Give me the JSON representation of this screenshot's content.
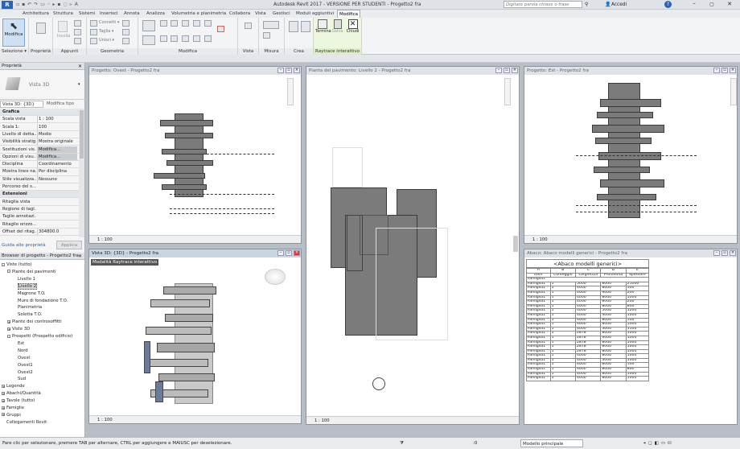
{
  "app_title": "Autodesk Revit 2017 -  VERSIONE PER STUDENTI -   Progetto2 fra",
  "search_placeholder": "Digitare parola chiave o frase",
  "signin": "Accedi",
  "ribbon_tabs": [
    "Architettura",
    "Struttura",
    "Sistemi",
    "Inserisci",
    "Annota",
    "Analizza",
    "Volumetria e planimetria",
    "Collabora",
    "Vista",
    "Gestisci",
    "Moduli aggiuntivi",
    "Modifica"
  ],
  "ribbon": {
    "modify_btn": "Modifica",
    "panels": [
      "Selezione ▾",
      "Proprietà",
      "Appunti",
      "Geometria",
      "Modifica",
      "Vista",
      "Misura",
      "Crea",
      "Raytrace interattivo"
    ],
    "geom_labels": [
      "Connetti ▾",
      "Taglia ▾",
      "Unisci ▾"
    ],
    "paste_label": "Incolla",
    "raytrace_btns": [
      "Termina",
      "Salva",
      "Chiudi"
    ]
  },
  "properties": {
    "header": "Proprietà",
    "type_name": "Vista 3D",
    "selector": "Vista 3D: {3D}",
    "edit_type": "Modifica tipo",
    "rows": [
      {
        "k": "Grafica",
        "v": "",
        "section": true
      },
      {
        "k": "Scala vista",
        "v": "1 : 100"
      },
      {
        "k": "Scala  1:",
        "v": "100"
      },
      {
        "k": "Livello di detta...",
        "v": "Medio"
      },
      {
        "k": "Visibilità stratig...",
        "v": "Mostra originale"
      },
      {
        "k": "Sostituzioni vis...",
        "v": "Modifica..."
      },
      {
        "k": "Opzioni di visu...",
        "v": "Modifica..."
      },
      {
        "k": "Disciplina",
        "v": "Coordinamento"
      },
      {
        "k": "Mostra linee na...",
        "v": "Per disciplina"
      },
      {
        "k": "Stile visualizza...",
        "v": "Nessuno"
      },
      {
        "k": "Percorso del s...",
        "v": ""
      },
      {
        "k": "Estensioni",
        "v": "",
        "section": true
      },
      {
        "k": "Ritaglia vista",
        "v": ""
      },
      {
        "k": "Regione di tagl...",
        "v": ""
      },
      {
        "k": "Taglio annotazi...",
        "v": ""
      },
      {
        "k": "Ritaglio orizzo...",
        "v": ""
      },
      {
        "k": "Offset del ritag...",
        "v": "304800.0"
      }
    ],
    "help_link": "Guida alle proprietà",
    "apply_btn": "Applica"
  },
  "browser": {
    "header": "Browser di progetto - Progetto2 fra",
    "items": [
      {
        "t": "Viste (tutto)",
        "lvl": 0,
        "tog": "-"
      },
      {
        "t": "Piante dei pavimenti",
        "lvl": 1,
        "tog": "-"
      },
      {
        "t": "Livello 1",
        "lvl": 2
      },
      {
        "t": "Livello 2",
        "lvl": 2,
        "sel": true
      },
      {
        "t": "Magrone T.O.",
        "lvl": 2
      },
      {
        "t": "Muro di fondazione T.O.",
        "lvl": 2
      },
      {
        "t": "Planimetria",
        "lvl": 2
      },
      {
        "t": "Soletta T.O.",
        "lvl": 2
      },
      {
        "t": "Piante dei controsoffitti",
        "lvl": 1,
        "tog": "+"
      },
      {
        "t": "Viste 3D",
        "lvl": 1,
        "tog": "+"
      },
      {
        "t": "Prospetti (Prospetto edificio)",
        "lvl": 1,
        "tog": "-"
      },
      {
        "t": "Est",
        "lvl": 2
      },
      {
        "t": "Nord",
        "lvl": 2
      },
      {
        "t": "Ovest",
        "lvl": 2
      },
      {
        "t": "Ovest1",
        "lvl": 2
      },
      {
        "t": "Ovest2",
        "lvl": 2
      },
      {
        "t": "Sud",
        "lvl": 2
      },
      {
        "t": "Legende",
        "lvl": 0,
        "tog": "+"
      },
      {
        "t": "Abachi/Quantità",
        "lvl": 0,
        "tog": "+"
      },
      {
        "t": "Tavole (tutto)",
        "lvl": 0,
        "tog": "+"
      },
      {
        "t": "Famiglie",
        "lvl": 0,
        "tog": "+"
      },
      {
        "t": "Gruppi",
        "lvl": 0,
        "tog": "+"
      },
      {
        "t": "Collegamenti Revit",
        "lvl": 0
      }
    ]
  },
  "views": {
    "ovest": {
      "title": "Progetto: Ovest - Progetto2 fra",
      "scale": "1 : 100"
    },
    "plan": {
      "title": "Pianta del pavimento: Livello 2 - Progetto2 fra",
      "scale": "1 : 100"
    },
    "est": {
      "title": "Progetto: Est - Progetto2 fra",
      "scale": "1 : 100"
    },
    "v3d": {
      "title": "Vista 3D: {3D} - Progetto2 fra",
      "scale": "1 : 100",
      "mode_label": "Modalità Raytrace interattivo"
    },
    "schedule": {
      "title": "Abaco: Abaco modelli generici - Progetto2 fra"
    }
  },
  "schedule": {
    "title": "<Abaco modelli generici>",
    "letters": [
      "A",
      "B",
      "C",
      "D",
      "E"
    ],
    "headers": [
      "Item",
      "Conteggio",
      "Larghezza",
      "Profondità",
      "Spessore"
    ],
    "group": "Famiglia1",
    "rows": [
      [
        "Famiglia1",
        "1",
        "5000",
        "8000",
        "21000"
      ],
      [
        "Famiglia1",
        "1",
        "4000",
        "8000",
        "500"
      ],
      [
        "Famiglia1",
        "1",
        "4000",
        "9000",
        "200"
      ],
      [
        "Famiglia1",
        "1",
        "4000",
        "8000",
        "1000"
      ],
      [
        "Famiglia1",
        "1",
        "4000",
        "8000",
        "200"
      ],
      [
        "Famiglia1",
        "1",
        "4000",
        "8000",
        "800"
      ],
      [
        "Famiglia1",
        "1",
        "4000",
        "5000",
        "1200"
      ],
      [
        "Famiglia1",
        "1",
        "4000",
        "4000",
        "1000"
      ],
      [
        "Famiglia1",
        "1",
        "4000",
        "8000",
        "100"
      ],
      [
        "Famiglia1",
        "1",
        "4000",
        "8000",
        "1000"
      ],
      [
        "Famiglia1",
        "1",
        "4000",
        "3000",
        "1100"
      ],
      [
        "Famiglia1",
        "1",
        "2878",
        "8000",
        "1000"
      ],
      [
        "Famiglia1",
        "1",
        "2878",
        "6000",
        "1000"
      ],
      [
        "Famiglia1",
        "1",
        "2878",
        "8000",
        "1000"
      ],
      [
        "Famiglia1",
        "1",
        "2878",
        "8000",
        "1000"
      ],
      [
        "Famiglia1",
        "1",
        "2878",
        "8000",
        "1000"
      ],
      [
        "Famiglia1",
        "1",
        "4000",
        "8000",
        "1000"
      ],
      [
        "Famiglia1",
        "1",
        "4000",
        "3000",
        "1000"
      ],
      [
        "Famiglia1",
        "1",
        "4000",
        "8000",
        "100"
      ],
      [
        "Famiglia1",
        "1",
        "4000",
        "8000",
        "800"
      ],
      [
        "Famiglia1",
        "1",
        "4000",
        "8000",
        "1000"
      ],
      [
        "Famiglia1",
        "1",
        "4000",
        "8000",
        "1000"
      ]
    ]
  },
  "statusbar": {
    "hint": "Fare clic per selezionare, premere TAB per alternare, CTRL per aggiungere e MAIUSC per deselezionare.",
    "coord": ":0",
    "model": "Modello principale"
  }
}
